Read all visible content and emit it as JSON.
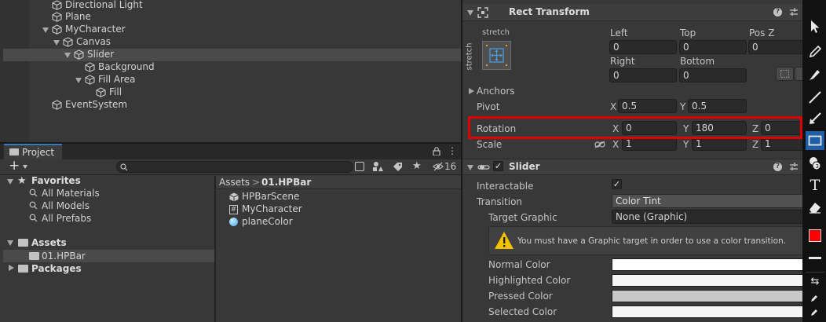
{
  "hierarchy": {
    "items": [
      {
        "label": "Directional Light"
      },
      {
        "label": "Plane"
      },
      {
        "label": "MyCharacter"
      },
      {
        "label": "Canvas"
      },
      {
        "label": "Slider"
      },
      {
        "label": "Background"
      },
      {
        "label": "Fill Area"
      },
      {
        "label": "Fill"
      },
      {
        "label": "EventSystem"
      }
    ]
  },
  "project": {
    "tab_label": "Project",
    "add_label": "+",
    "hidden_count": "16",
    "favorites": {
      "label": "Favorites",
      "items": [
        "All Materials",
        "All Models",
        "All Prefabs"
      ]
    },
    "assets": {
      "label": "Assets",
      "items": [
        "01.HPBar"
      ]
    },
    "packages": {
      "label": "Packages"
    },
    "breadcrumb": {
      "root": "Assets",
      "separator": ">",
      "current": "01.HPBar"
    },
    "files": [
      {
        "name": "HPBarScene"
      },
      {
        "name": "MyCharacter"
      },
      {
        "name": "planeColor"
      }
    ]
  },
  "rect_transform": {
    "title": "Rect Transform",
    "anchor_top_label": "stretch",
    "anchor_side_label": "stretch",
    "left_label": "Left",
    "left_value": "0",
    "top_label": "Top",
    "top_value": "0",
    "posz_label": "Pos Z",
    "posz_value": "0",
    "right_label": "Right",
    "right_value": "0",
    "bottom_label": "Bottom",
    "bottom_value": "0",
    "anchors_label": "Anchors",
    "pivot": {
      "label": "Pivot",
      "x_label": "X",
      "x": "0.5",
      "y_label": "Y",
      "y": "0.5"
    },
    "rotation": {
      "label": "Rotation",
      "x_label": "X",
      "x": "0",
      "y_label": "Y",
      "y": "180",
      "z_label": "Z",
      "z": "0"
    },
    "scale": {
      "label": "Scale",
      "x_label": "X",
      "x": "1",
      "y_label": "Y",
      "y": "1",
      "z_label": "Z",
      "z": "1"
    }
  },
  "slider": {
    "title": "Slider",
    "interactable_label": "Interactable",
    "interactable_checked": true,
    "transition_label": "Transition",
    "transition_value": "Color Tint",
    "target_graphic_label": "Target Graphic",
    "target_graphic_value": "None (Graphic)",
    "warning": "You must have a Graphic target in order to use a color transition.",
    "normal_color_label": "Normal Color",
    "highlighted_color_label": "Highlighted Color",
    "pressed_color_label": "Pressed Color",
    "selected_color_label": "Selected Color"
  },
  "colors": {
    "highlight_box": "#e00000",
    "tool_active": "#3d8ae6",
    "color_swatch": "#ff0000"
  }
}
